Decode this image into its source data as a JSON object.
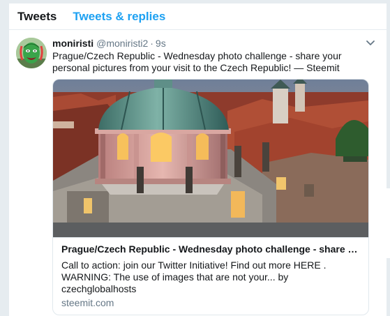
{
  "tabs": [
    {
      "label": "Tweets",
      "active": true
    },
    {
      "label": "Tweets & replies",
      "active": false
    }
  ],
  "tweet": {
    "name": "moniristi",
    "handle": "@moniristi2",
    "separator": "·",
    "time": "9s",
    "text": "Prague/Czech Republic - Wednesday photo challenge - share your personal pictures from your visit to the Czech Republic! — Steemit",
    "card": {
      "title": "Prague/Czech Republic - Wednesday photo challenge - share yo...",
      "description": "Call to action: join our Twitter Initiative! Find out more HERE . WARNING: The use of images that are not your... by czechglobalhosts",
      "domain": "steemit.com"
    }
  },
  "colors": {
    "accent": "#1da1f2",
    "text": "#14171a",
    "muted": "#657786",
    "border": "#e1e8ed",
    "background": "#e6ecf0"
  },
  "icons": {
    "caret": "chevron-down-icon",
    "avatar": "green-face-avatar",
    "photo": "prague-dome-photo"
  }
}
